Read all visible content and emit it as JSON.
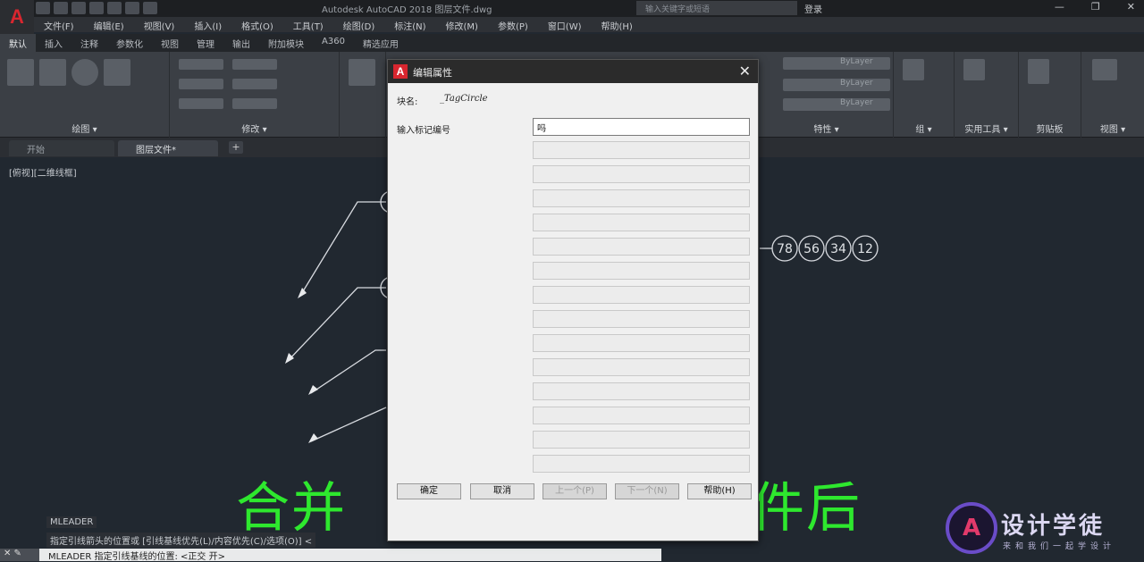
{
  "app": {
    "logo_letter": "A",
    "window_title": "Autodesk AutoCAD 2018   图层文件.dwg",
    "search_placeholder": "输入关键字或短语",
    "login_label": "登录",
    "window_controls": [
      "—",
      "❐",
      "✕"
    ]
  },
  "menubar": [
    "文件(F)",
    "编辑(E)",
    "视图(V)",
    "插入(I)",
    "格式(O)",
    "工具(T)",
    "绘图(D)",
    "标注(N)",
    "修改(M)",
    "参数(P)",
    "窗口(W)",
    "帮助(H)"
  ],
  "ribbon_tabs": [
    "默认",
    "插入",
    "注释",
    "参数化",
    "视图",
    "管理",
    "输出",
    "附加模块",
    "A360",
    "精选应用"
  ],
  "ribbon_panels": [
    "绘图 ▾",
    "修改 ▾",
    "特性 ▾",
    "组 ▾",
    "实用工具 ▾",
    "剪贴板",
    "视图 ▾"
  ],
  "layer_values": [
    "ByLayer",
    "ByLayer",
    "ByLayer"
  ],
  "document_tabs": [
    "开始",
    "图层文件*"
  ],
  "view_label": "[俯视][二维线框]",
  "canvas": {
    "tag_circles": [
      "78",
      "56",
      "34",
      "12"
    ],
    "big_text_left": "合并",
    "big_text_right": "件后",
    "command_history": [
      "MLEADER",
      "指定引线箭头的位置或 [引线基线优先(L)/内容优先(C)/选项(O)] <"
    ],
    "command_prompt": "MLEADER 指定引线基线的位置: <正交 开>"
  },
  "dialog": {
    "title": "编辑属性",
    "block_name_label": "块名:",
    "block_name_value": "_TagCircle",
    "attribute_label": "输入标记编号",
    "attribute_value": "吗",
    "empty_fields": 14,
    "buttons": {
      "ok": "确定",
      "cancel": "取消",
      "previous": "上一个(P)",
      "next": "下一个(N)",
      "help": "帮助(H)"
    }
  },
  "watermark": {
    "badge_letter": "A",
    "title": "设计学徒",
    "subtitle": "来和我们一起学设计"
  },
  "colors": {
    "canvas_bg": "#212830",
    "green_text": "#2ee82e",
    "dialog_bg": "#f0f0f0"
  }
}
